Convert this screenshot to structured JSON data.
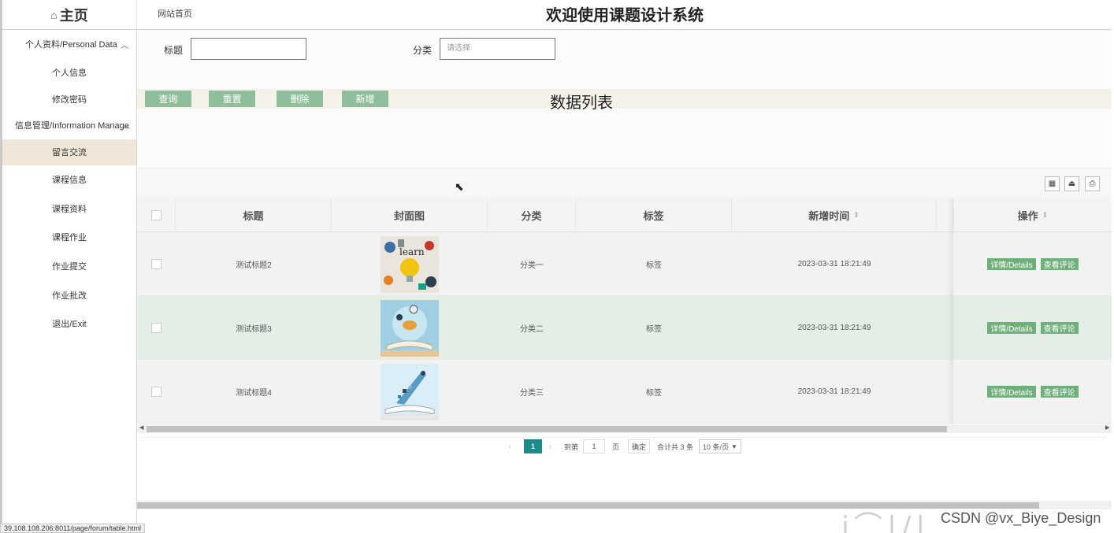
{
  "header": {
    "home_label": "主页",
    "site_link": "网站首页",
    "title": "欢迎使用课题设计系统"
  },
  "sidebar": {
    "groups": [
      {
        "label": "个人资料/Personal Data",
        "items": [
          "个人信息",
          "修改密码"
        ]
      },
      {
        "label": "信息管理/Information Manage",
        "items": [
          "留言交流",
          "课程信息",
          "课程资料",
          "课程作业",
          "作业提交",
          "作业批改",
          "退出/Exit"
        ]
      }
    ],
    "active_item": "留言交流"
  },
  "filter": {
    "title_label": "标题",
    "title_value": "",
    "category_label": "分类",
    "category_placeholder": "请选择",
    "buttons": {
      "query": "查询",
      "reset": "重置",
      "delete": "删除",
      "add": "新增"
    },
    "list_title": "数据列表"
  },
  "table": {
    "columns": [
      "标题",
      "封面图",
      "分类",
      "标签",
      "新增时间",
      "操作"
    ],
    "rows": [
      {
        "title": "测试标题2",
        "category": "分类一",
        "tag": "标签",
        "time": "2023-03-31 18:21:49"
      },
      {
        "title": "测试标题3",
        "category": "分类二",
        "tag": "标签",
        "time": "2023-03-31 18:21:49"
      },
      {
        "title": "测试标题4",
        "category": "分类三",
        "tag": "标签",
        "time": "2023-03-31 18:21:49"
      }
    ],
    "row_actions": {
      "details": "详情/Details",
      "comments": "查看评论"
    }
  },
  "pagination": {
    "current_page": "1",
    "goto_label": "到第",
    "goto_value": "1",
    "page_unit": "页",
    "confirm": "确定",
    "total": "合计共 3 条",
    "page_size": "10 条/页"
  },
  "status_url": "39.108.108.206:8011/page/forum/table.html",
  "watermark": "CSDN @vx_Biye_Design",
  "colors": {
    "button_green": "#8fbf9a",
    "action_green": "#6fb07a",
    "pager_active": "#1f8a8a",
    "active_menu_bg": "#f0e7d8",
    "selected_row_bg": "#e3efe6"
  }
}
